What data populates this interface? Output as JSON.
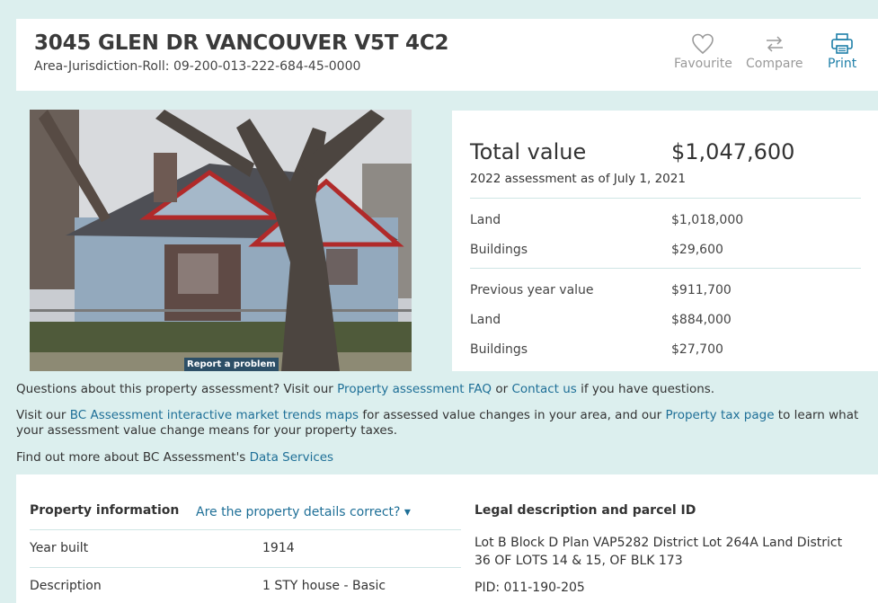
{
  "header": {
    "address": "3045 GLEN DR VANCOUVER V5T 4C2",
    "roll_label": "Area-Jurisdiction-Roll:",
    "roll_value": "09-200-013-222-684-45-0000",
    "actions": {
      "favourite": "Favourite",
      "compare": "Compare",
      "print": "Print"
    }
  },
  "photo": {
    "report_label": "Report a problem"
  },
  "values": {
    "total_label": "Total value",
    "total_value": "$1,047,600",
    "assessment_note": "2022 assessment as of July 1, 2021",
    "current": [
      {
        "label": "Land",
        "value": "$1,018,000"
      },
      {
        "label": "Buildings",
        "value": "$29,600"
      }
    ],
    "previous": [
      {
        "label": "Previous year value",
        "value": "$911,700"
      },
      {
        "label": "Land",
        "value": "$884,000"
      },
      {
        "label": "Buildings",
        "value": "$27,700"
      }
    ]
  },
  "info": {
    "p1_a": "Questions about this property assessment? Visit our ",
    "p1_link1": "Property assessment FAQ",
    "p1_b": " or ",
    "p1_link2": "Contact us",
    "p1_c": " if you have questions.",
    "p2_a": "Visit our ",
    "p2_link1": "BC Assessment interactive market trends maps",
    "p2_b": " for assessed value changes in your area, and our ",
    "p2_link2": "Property tax page",
    "p2_c": " to learn what your assessment value change means for your property taxes.",
    "p3_a": "Find out more about BC Assessment's ",
    "p3_link": "Data Services"
  },
  "property": {
    "heading": "Property information",
    "details_link": "Are the property details correct? ▾",
    "rows": [
      {
        "label": "Year built",
        "value": "1914"
      },
      {
        "label": "Description",
        "value": "1 STY house - Basic"
      }
    ]
  },
  "legal": {
    "heading": "Legal description and parcel ID",
    "description": "Lot B Block D Plan VAP5282 District Lot 264A Land District 36 OF LOTS 14 & 15, OF BLK 173",
    "pid": "PID: 011-190-205"
  },
  "colors": {
    "page_bg": "#dcefee",
    "link": "#1e6f97",
    "print_accent": "#1e7fa8",
    "report_bg": "#2d4f67"
  }
}
